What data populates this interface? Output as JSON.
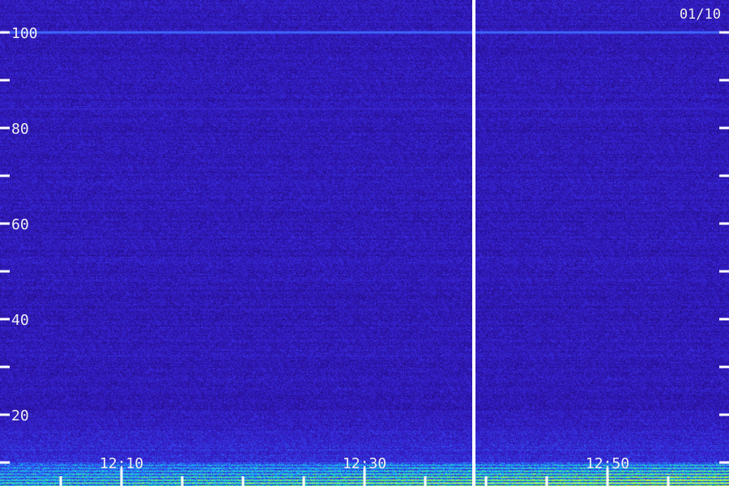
{
  "chart_data": {
    "type": "heatmap",
    "title": "",
    "date_label": "01/10",
    "xlabel": "",
    "ylabel": "",
    "y_axis": {
      "range": [
        0,
        100
      ],
      "labeled_ticks": [
        20,
        40,
        60,
        80,
        100
      ],
      "minor_ticks": [
        10,
        30,
        50,
        70,
        90
      ]
    },
    "x_axis": {
      "labeled_ticks": [
        "12:10",
        "12:30",
        "12:50"
      ],
      "range": [
        "12:00",
        "13:00"
      ],
      "tick_interval_minutes": 5
    },
    "marker_time": "12:39",
    "colormap": [
      "#1a0a4a",
      "#2a10a0",
      "#3a2ae0",
      "#1f8cff",
      "#19e0d0",
      "#7dff40",
      "#ffff20"
    ],
    "background_color": "#220d55",
    "features": [
      {
        "type": "persistent_line",
        "y": 100,
        "intensity": 0.55
      },
      {
        "type": "persistent_line",
        "y": 84,
        "intensity": 0.28
      },
      {
        "type": "low_band",
        "y_range": [
          0,
          10
        ],
        "intensity_start": 0.5,
        "intensity_end": 0.95
      }
    ]
  }
}
